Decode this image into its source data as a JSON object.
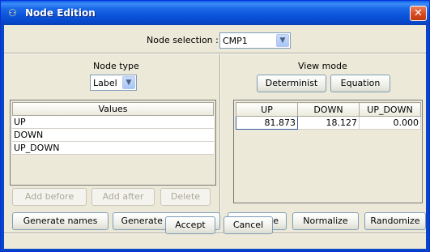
{
  "window": {
    "title": "Node Edition",
    "close_icon": "close-x-icon",
    "app_icon": "node-icon"
  },
  "node_selection": {
    "label": "Node selection :",
    "value": "CMP1"
  },
  "node_type": {
    "label": "Node type",
    "value": "Label"
  },
  "view_mode": {
    "label": "View mode",
    "determinist": "Determinist",
    "equation": "Equation"
  },
  "values": {
    "header": "Values",
    "items": [
      "UP",
      "DOWN",
      "UP_DOWN"
    ],
    "add_before": "Add before",
    "add_after": "Add after",
    "delete": "Delete",
    "generate_names": "Generate names",
    "generate_modalities": "Generate modalities"
  },
  "table": {
    "columns": [
      "UP",
      "DOWN",
      "UP_DOWN"
    ],
    "rows": [
      [
        "81.873",
        "18.127",
        "0.000"
      ]
    ]
  },
  "actions": {
    "complete": "Complete",
    "normalize": "Normalize",
    "randomize": "Randomize"
  },
  "footer": {
    "accept": "Accept",
    "cancel": "Cancel"
  }
}
